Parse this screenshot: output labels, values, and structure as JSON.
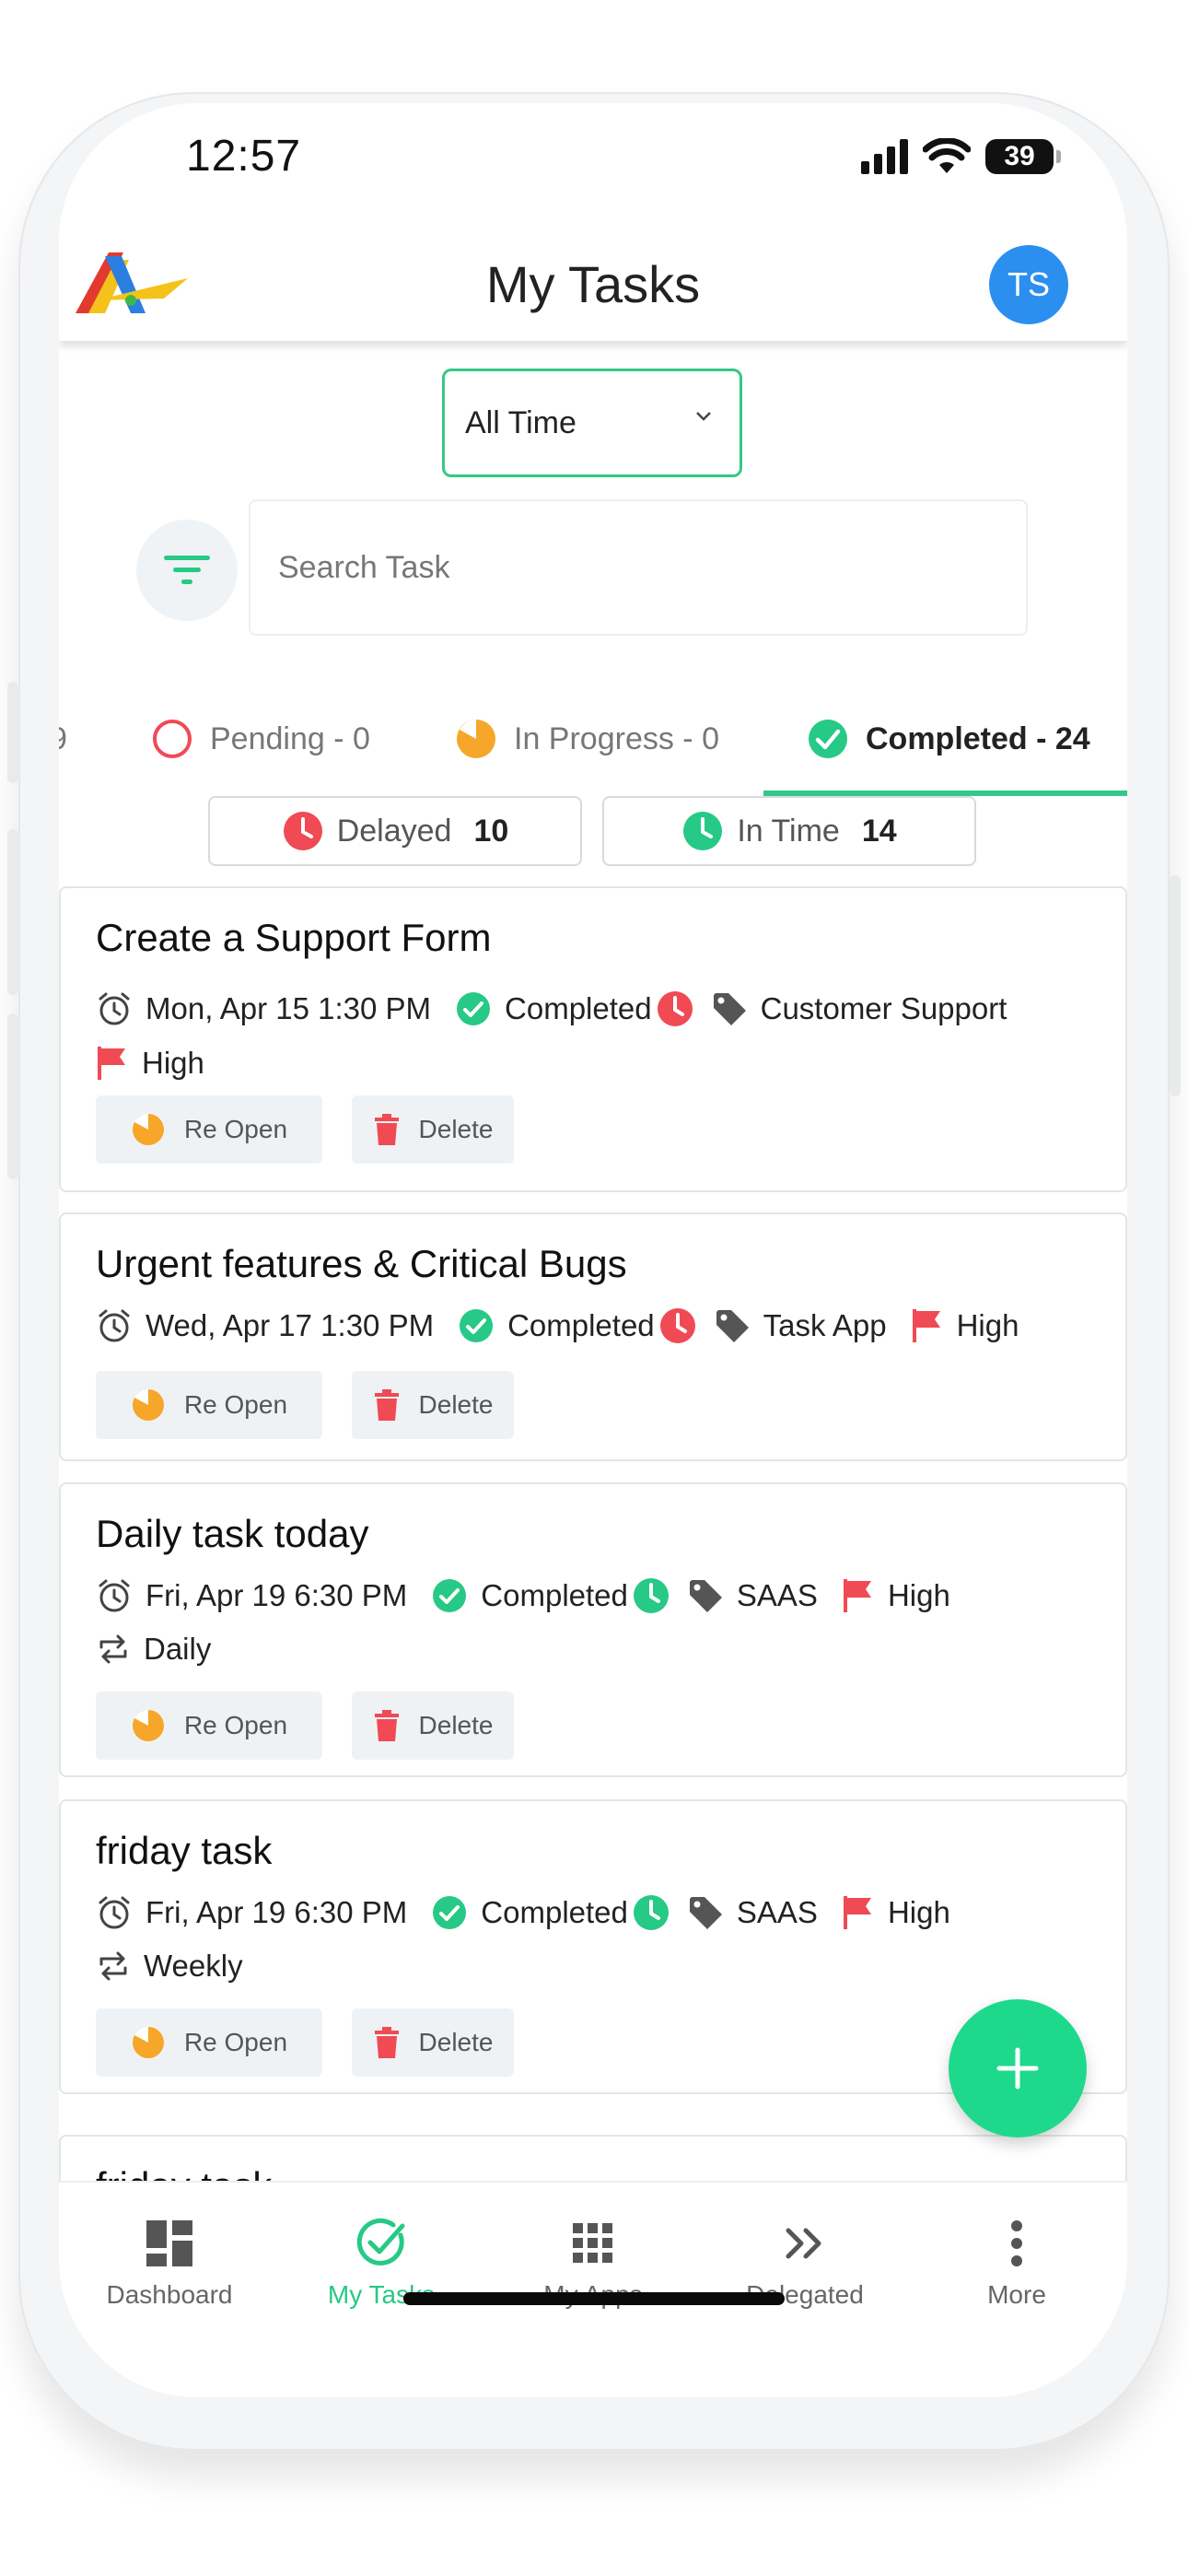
{
  "status_bar": {
    "time": "12:57",
    "battery": "39"
  },
  "header": {
    "title": "My Tasks",
    "avatar_initials": "TS"
  },
  "time_filter": {
    "selected": "All Time"
  },
  "search": {
    "placeholder": "Search Task"
  },
  "status_tabs": [
    {
      "label": "9",
      "partial": true
    },
    {
      "label": "Pending - 0"
    },
    {
      "label": "In Progress - 0"
    },
    {
      "label": "Completed - 24",
      "active": true
    }
  ],
  "sub_filters": [
    {
      "label": "Delayed",
      "count": "10"
    },
    {
      "label": "In Time",
      "count": "14"
    }
  ],
  "tasks": [
    {
      "title": "Create a Support Form",
      "date": "Mon, Apr 15 1:30 PM",
      "status": "Completed",
      "timing": "delayed",
      "tag": "Customer Support",
      "priority": "High",
      "repeat": ""
    },
    {
      "title": "Urgent features & Critical Bugs",
      "date": "Wed, Apr 17 1:30 PM",
      "status": "Completed",
      "timing": "delayed",
      "tag": "Task App",
      "priority": "High",
      "repeat": ""
    },
    {
      "title": "Daily task today",
      "date": "Fri, Apr 19 6:30 PM",
      "status": "Completed",
      "timing": "in-time",
      "tag": "SAAS",
      "priority": "High",
      "repeat": "Daily"
    },
    {
      "title": "friday task",
      "date": "Fri, Apr 19 6:30 PM",
      "status": "Completed",
      "timing": "in-time",
      "tag": "SAAS",
      "priority": "High",
      "repeat": "Weekly"
    }
  ],
  "actions": {
    "reopen": "Re Open",
    "delete": "Delete"
  },
  "partial_task_title": "friday task",
  "bottom_nav": [
    {
      "label": "Dashboard"
    },
    {
      "label": "My Tasks",
      "active": true
    },
    {
      "label": "My Apps"
    },
    {
      "label": "Delegated"
    },
    {
      "label": "More"
    }
  ],
  "colors": {
    "accent": "#26c985",
    "danger": "#f04a55",
    "progress": "#f6a629",
    "avatar": "#2b8ff0",
    "fab": "#1ed98b"
  }
}
